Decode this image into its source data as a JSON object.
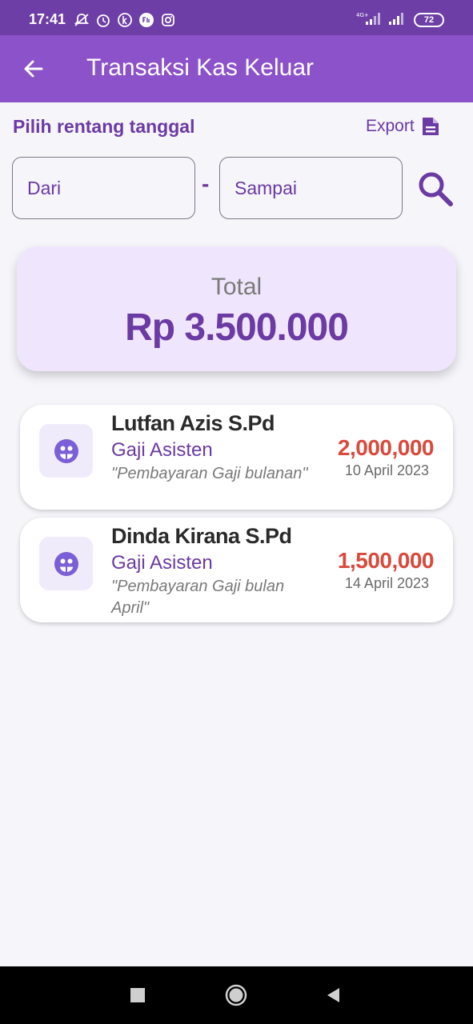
{
  "status_bar": {
    "time": "17:41",
    "icons": [
      "notifications-off-icon",
      "alarm-icon",
      "k-app-icon",
      "flip-app-icon",
      "instagram-icon"
    ],
    "network": "4G+",
    "battery": "72"
  },
  "app_bar": {
    "title": "Transaksi Kas Keluar",
    "back_icon": "arrow-left-icon"
  },
  "filter": {
    "label": "Pilih rentang tanggal",
    "export_label": "Export",
    "export_icon": "file-document-icon",
    "from_placeholder": "Dari",
    "separator": "-",
    "to_placeholder": "Sampai",
    "search_icon": "search-icon"
  },
  "total": {
    "label": "Total",
    "value": "Rp 3.500.000"
  },
  "transactions": [
    {
      "name": "Lutfan Azis S.Pd",
      "category": "Gaji Asisten",
      "note": "\"Pembayaran Gaji bulanan\"",
      "amount": "2,000,000",
      "date": "10 April 2023"
    },
    {
      "name": "Dinda Kirana S.Pd",
      "category": "Gaji Asisten",
      "note": "\"Pembayaran Gaji bulan April\"",
      "amount": "1,500,000",
      "date": "14 April 2023"
    }
  ],
  "colors": {
    "status_bar": "#6d3ea6",
    "app_bar": "#8c52c9",
    "primary_text": "#6b3aa3",
    "amount": "#d94a3d",
    "total_card": "#efe5fc",
    "background": "#f5f5fa"
  },
  "nav_bar": {
    "icons": [
      "recents-square-icon",
      "home-circle-icon",
      "back-triangle-icon"
    ]
  }
}
